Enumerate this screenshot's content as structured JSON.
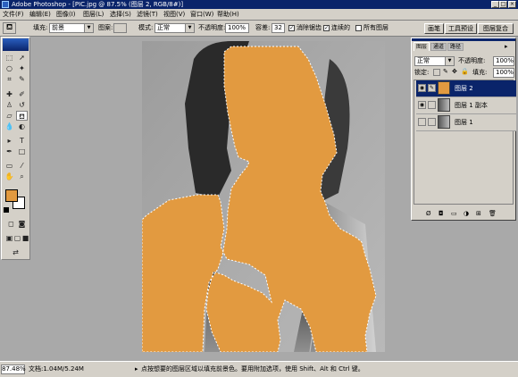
{
  "window": {
    "title": "Adobe Photoshop - [PIC.jpg @ 87.5% (图层 2, RGB/8#)]",
    "buttons": [
      "_",
      "□",
      "×"
    ]
  },
  "menubar": {
    "items": [
      "文件(F)",
      "编辑(E)",
      "图像(I)",
      "图层(L)",
      "选择(S)",
      "滤镜(T)",
      "视图(V)",
      "窗口(W)",
      "帮助(H)"
    ]
  },
  "options": {
    "fill_label": "填充:",
    "fill_value": "前景",
    "pattern_label": "图案:",
    "mode_label": "模式:",
    "mode_value": "正常",
    "opacity_label": "不透明度:",
    "opacity_value": "100%",
    "tolerance_label": "容差:",
    "tolerance_value": "32",
    "antialias_label": "消除锯齿",
    "contiguous_label": "连续的",
    "all_layers_label": "所有图层",
    "tabs": [
      "画笔",
      "工具预设",
      "图层复合"
    ]
  },
  "colors": {
    "fill": "#e29a40",
    "fg": "#e29a40",
    "bg": "#ffffff",
    "selected_row": "#0a246a",
    "chrome": "#d4d0c8"
  },
  "layers_panel": {
    "tabs": [
      "图层",
      "通道",
      "路径"
    ],
    "blend_mode": "正常",
    "opacity_label": "不透明度:",
    "opacity_value": "100%",
    "lock_label": "锁定:",
    "fill_label": "填充:",
    "fill_value": "100%",
    "layers": [
      {
        "name": "图层 2",
        "selected": true,
        "visible": true
      },
      {
        "name": "图层 1 副本",
        "selected": false,
        "visible": true
      },
      {
        "name": "图层 1",
        "selected": false,
        "visible": false
      }
    ]
  },
  "status": {
    "zoom": "87.48%",
    "doc_info": "文档:1.04M/5.24M",
    "hint": "点按想要的图层区域以填充前景色。要用附加选项，使用 Shift、Alt 和 Ctrl 键。"
  }
}
